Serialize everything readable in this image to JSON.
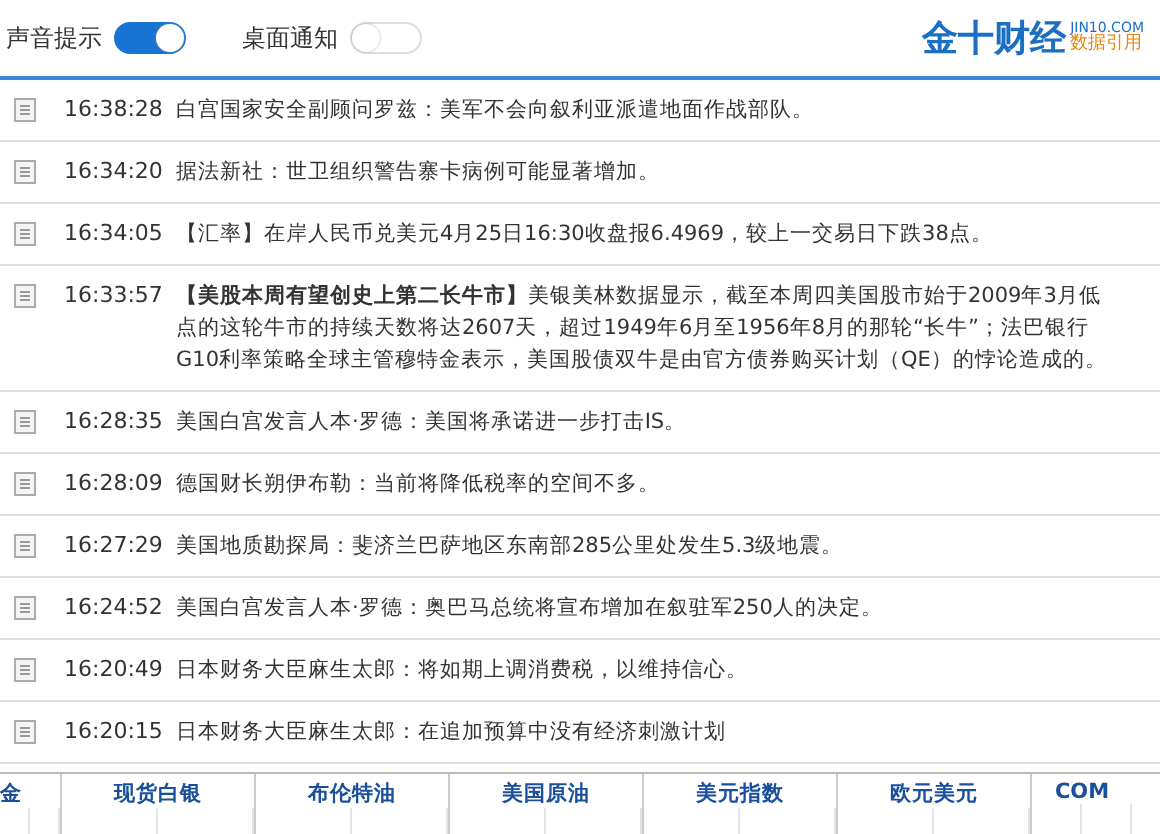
{
  "header": {
    "toggles": [
      {
        "label": "声音提示",
        "on": true
      },
      {
        "label": "桌面通知",
        "on": false
      }
    ],
    "logo": {
      "name": "金十财经",
      "domain": "JIN10.COM",
      "tagline": "数据引用"
    }
  },
  "news": [
    {
      "time": "16:38:28",
      "text": "白宫国家安全副顾问罗兹：美军不会向叙利亚派遣地面作战部队。"
    },
    {
      "time": "16:34:20",
      "text": "据法新社：世卫组织警告寨卡病例可能显著增加。"
    },
    {
      "time": "16:34:05",
      "text": "【汇率】在岸人民币兑美元4月25日16:30收盘报6.4969，较上一交易日下跌38点。"
    },
    {
      "time": "16:33:57",
      "text": "**【美股本周有望创史上第二长牛市】**美银美林数据显示，截至本周四美国股市始于2009年3月低点的这轮牛市的持续天数将达2607天，超过1949年6月至1956年8月的那轮“长牛”；法巴银行G10利率策略全球主管穆特金表示，美国股债双牛是由官方债券购买计划（QE）的悖论造成的。"
    },
    {
      "time": "16:28:35",
      "text": "美国白宫发言人本·罗德：美国将承诺进一步打击IS。"
    },
    {
      "time": "16:28:09",
      "text": "德国财长朔伊布勒：当前将降低税率的空间不多。"
    },
    {
      "time": "16:27:29",
      "text": "美国地质勘探局：斐济兰巴萨地区东南部285公里处发生5.3级地震。"
    },
    {
      "time": "16:24:52",
      "text": "美国白宫发言人本·罗德：奥巴马总统将宣布增加在叙驻军250人的决定。"
    },
    {
      "time": "16:20:49",
      "text": "日本财务大臣麻生太郎：将如期上调消费税，以维持信心。"
    },
    {
      "time": "16:20:15",
      "text": "日本财务大臣麻生太郎：在追加预算中没有经济刺激计划"
    }
  ],
  "ticker": [
    "金",
    "现货白银",
    "布伦特油",
    "美国原油",
    "美元指数",
    "欧元美元",
    "COM"
  ]
}
